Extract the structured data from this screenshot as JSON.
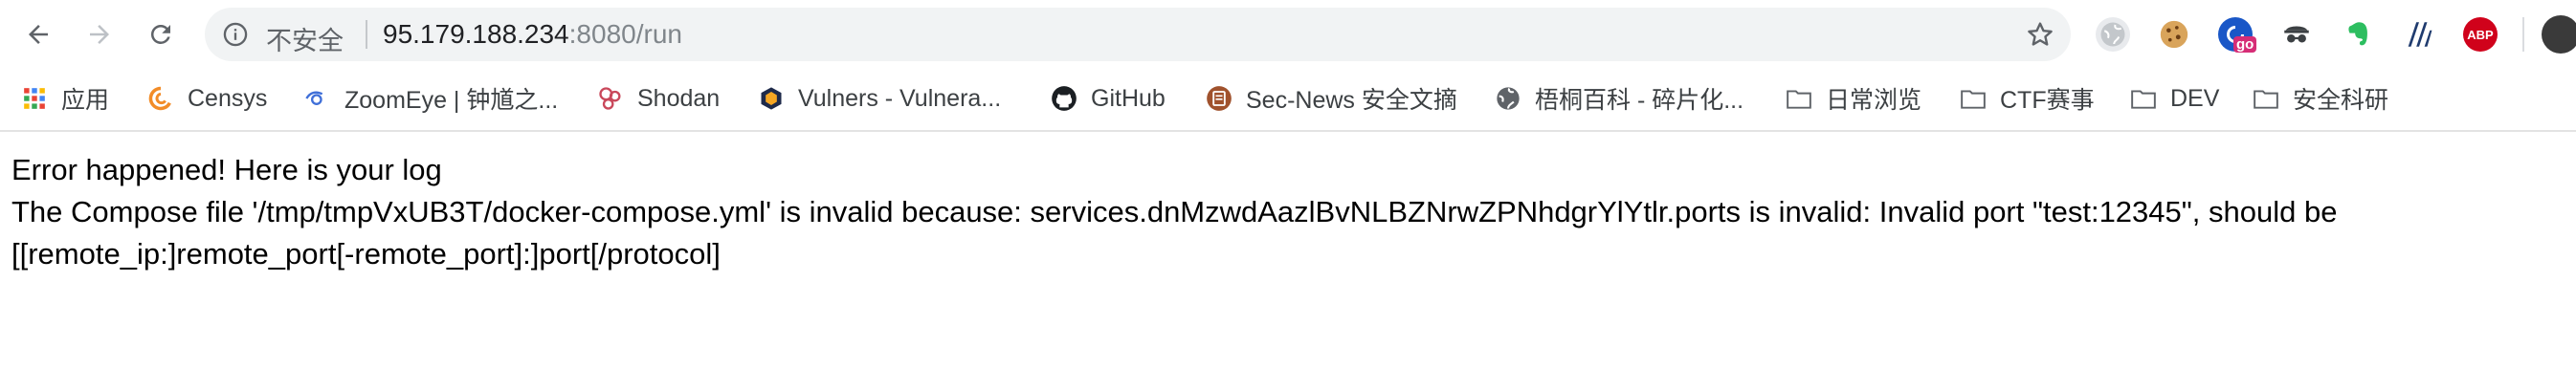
{
  "browser": {
    "security_label": "不安全",
    "url_host": "95.179.188.234",
    "url_rest": ":8080/run",
    "nav_icons": [
      "back-arrow-icon",
      "forward-arrow-icon",
      "reload-icon"
    ],
    "extension_icons": [
      "globe-extension-icon",
      "cookie-extension-icon",
      "go-extension-icon",
      "spy-extension-icon",
      "evernote-extension-icon",
      "a-extension-icon",
      "abp-extension-icon"
    ],
    "abp_label": "ABP",
    "go_label": "go"
  },
  "bookmarks": [
    {
      "label": "应用",
      "icon": "apps-grid-icon"
    },
    {
      "label": "Censys",
      "icon": "censys-icon"
    },
    {
      "label": "ZoomEye | 钟馗之...",
      "icon": "zoomeye-icon"
    },
    {
      "label": "Shodan",
      "icon": "shodan-icon"
    },
    {
      "label": "Vulners - Vulnera...",
      "icon": "vulners-icon"
    },
    {
      "label": "GitHub",
      "icon": "github-icon"
    },
    {
      "label": "Sec-News 安全文摘",
      "icon": "secnews-icon"
    },
    {
      "label": "梧桐百科 - 碎片化...",
      "icon": "globe-icon"
    },
    {
      "label": "日常浏览",
      "icon": "folder-icon"
    },
    {
      "label": "CTF赛事",
      "icon": "folder-icon"
    },
    {
      "label": "DEV",
      "icon": "folder-icon"
    },
    {
      "label": "安全科研",
      "icon": "folder-icon"
    }
  ],
  "page": {
    "line1": "Error happened! Here is your log",
    "line2": "The Compose file '/tmp/tmpVxUB3T/docker-compose.yml' is invalid because: services.dnMzwdAazlBvNLBZNrwZPNhdgrYlYtlr.ports is invalid: Invalid port \"test:12345\", should be",
    "line3": "[[remote_ip:]remote_port[-remote_port]:]port[/protocol]"
  }
}
